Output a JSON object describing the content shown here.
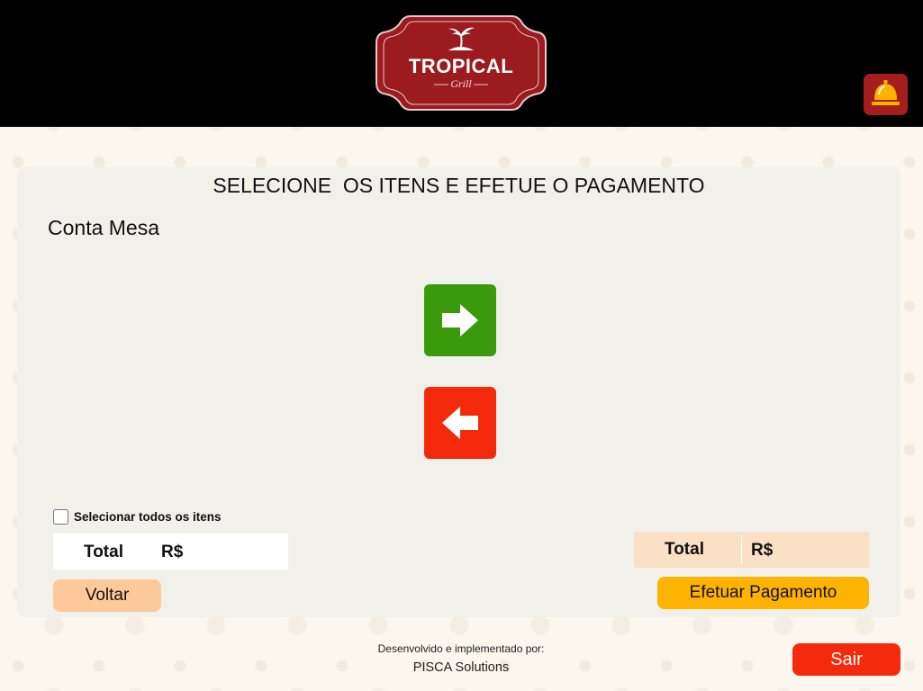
{
  "header": {
    "logo": {
      "name": "TROPICAL",
      "subtitle": "Grill",
      "icon": "palm-tree-icon",
      "background_color": "#9b1b1e"
    },
    "service_bell": {
      "icon": "service-bell-icon",
      "background_color": "#a51e1e",
      "icon_color": "#ffb300"
    }
  },
  "panel": {
    "title": "SELECIONE  OS ITENS E EFETUE O PAGAMENTO",
    "account_label": "Conta Mesa",
    "move_right": {
      "icon": "arrow-right-icon",
      "color": "#3b9a0b"
    },
    "move_left": {
      "icon": "arrow-left-icon",
      "color": "#f52a0c"
    },
    "select_all_label": "Selecionar todos os itens",
    "select_all_checked": false,
    "left_total": {
      "label": "Total",
      "currency": "R$"
    },
    "right_total": {
      "label": "Total",
      "currency": "R$"
    },
    "back_button_label": "Voltar",
    "pay_button_label": "Efetuar Pagamento"
  },
  "footer": {
    "credit_line1": "Desenvolvido e implementado por:",
    "credit_line2": "PISCA Solutions",
    "exit_button_label": "Sair"
  }
}
